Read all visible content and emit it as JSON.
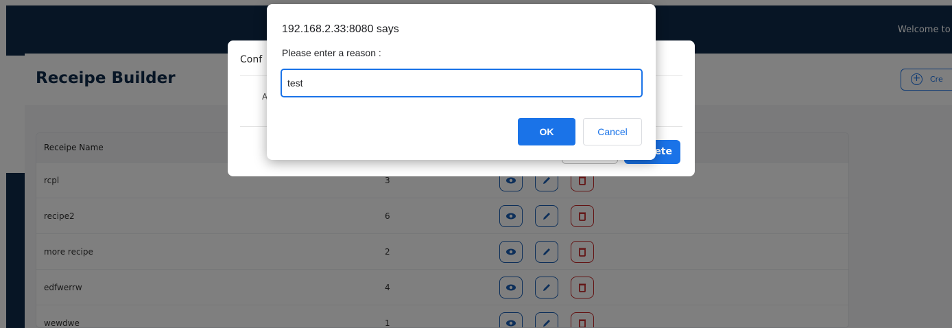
{
  "app": {
    "welcome_text": "Welcome to",
    "page_title": "Receipe Builder",
    "create_button_label": "Cre"
  },
  "table": {
    "columns": [
      "Receipe Name"
    ],
    "rows": [
      {
        "name": "rcpl",
        "count": "3"
      },
      {
        "name": "recipe2",
        "count": "6"
      },
      {
        "name": "more recipe",
        "count": "2"
      },
      {
        "name": "edfwerrw",
        "count": "4"
      },
      {
        "name": "wewdwe",
        "count": "1"
      }
    ],
    "actions": [
      "eye-icon",
      "pencil-icon",
      "trash-icon"
    ]
  },
  "confirm_dialog": {
    "title": "Conf",
    "body": "A",
    "delete_label": "ete"
  },
  "prompt_dialog": {
    "origin": "192.168.2.33:8080 says",
    "message": "Please enter a reason :",
    "input_value": "test",
    "ok_label": "OK",
    "cancel_label": "Cancel"
  },
  "colors": {
    "navy": "#0e2a4a",
    "primary": "#1a73e8",
    "danger": "#c62828"
  }
}
